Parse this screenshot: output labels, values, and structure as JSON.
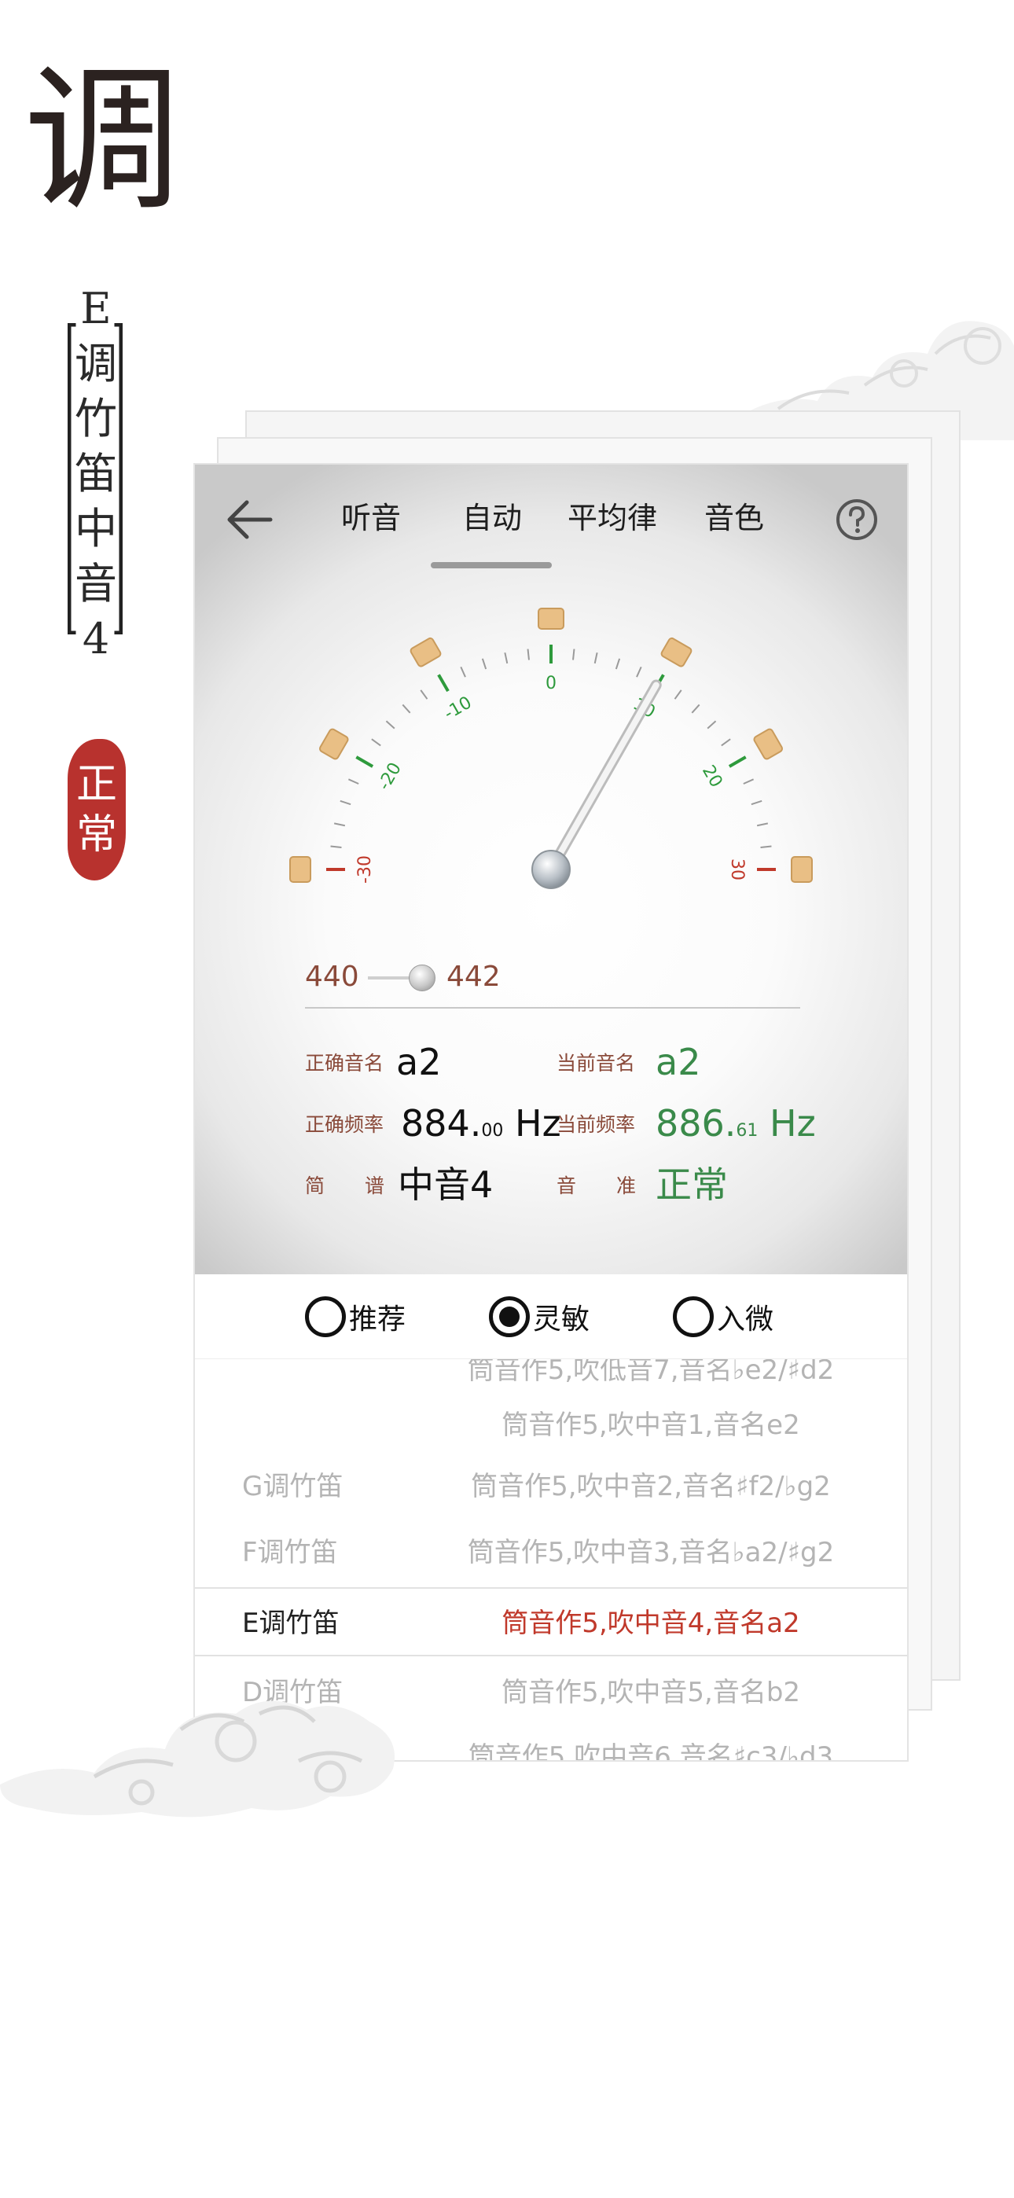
{
  "title_char": "调",
  "vertical_title": [
    "E",
    "调",
    "竹",
    "笛",
    "中",
    "音",
    "4"
  ],
  "seal_text": [
    "正",
    "常"
  ],
  "nav": {
    "tabs": [
      "听音",
      "自动",
      "平均律",
      "音色"
    ],
    "active_tab": "自动"
  },
  "gauge": {
    "ticks_left": [
      "-30",
      "-20",
      "-10"
    ],
    "tick_center": "0",
    "ticks_right": [
      "10",
      "20",
      "30"
    ],
    "needle_cents": 3,
    "colors": {
      "green": "#2e9a3c",
      "red": "#c0392b"
    }
  },
  "reference": {
    "min": "440",
    "max": "442"
  },
  "info": {
    "correct_name_label": "正确音名",
    "correct_name": "a2",
    "current_name_label": "当前音名",
    "current_name": "a2",
    "correct_freq_label": "正确频率",
    "correct_freq_int": "884.",
    "correct_freq_dec": "00",
    "correct_freq_unit": "Hz",
    "current_freq_label": "当前频率",
    "current_freq_int": "886.",
    "current_freq_dec": "61",
    "current_freq_unit": "Hz",
    "jianpu_label_a": "简",
    "jianpu_label_b": "谱",
    "jianpu_value": "中音4",
    "pitch_label_a": "音",
    "pitch_label_b": "准",
    "pitch_value": "正常"
  },
  "modes": [
    {
      "label": "推荐",
      "selected": false
    },
    {
      "label": "灵敏",
      "selected": true
    },
    {
      "label": "入微",
      "selected": false
    }
  ],
  "list": [
    {
      "left": "",
      "right": "筒音作5,吹低音7,音名♭e2/♯d2"
    },
    {
      "left": "",
      "right": "筒音作5,吹中音1,音名e2"
    },
    {
      "left": "G调竹笛",
      "right": "筒音作5,吹中音2,音名♯f2/♭g2"
    },
    {
      "left": "F调竹笛",
      "right": "筒音作5,吹中音3,音名♭a2/♯g2"
    },
    {
      "left": "E调竹笛",
      "right": "筒音作5,吹中音4,音名a2"
    },
    {
      "left": "D调竹笛",
      "right": "筒音作5,吹中音5,音名b2"
    },
    {
      "left": "",
      "right": "筒音作5,吹中音6,音名♯c3/♭d3"
    }
  ],
  "active_list_index": 4
}
